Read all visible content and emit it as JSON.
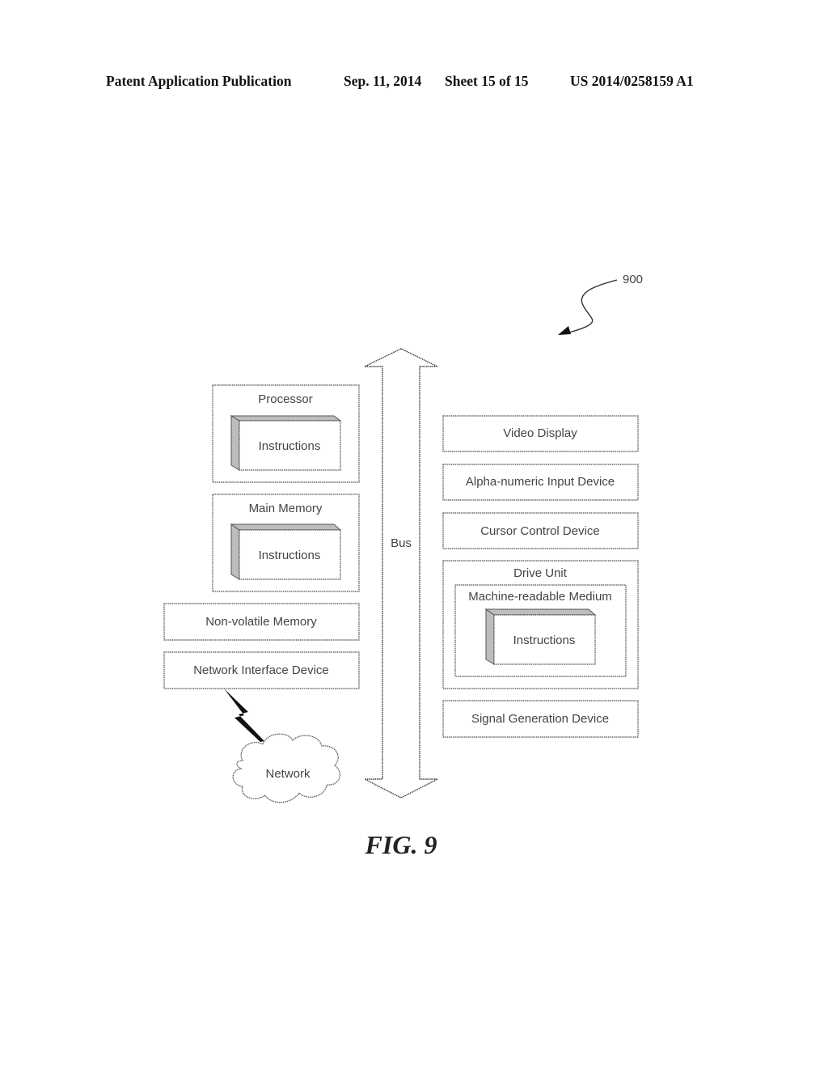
{
  "header": {
    "publication": "Patent Application Publication",
    "date": "Sep. 11, 2014",
    "sheet": "Sheet 15 of 15",
    "number": "US 2014/0258159 A1"
  },
  "figure": {
    "reference_numeral": "900",
    "caption": "FIG. 9",
    "bus_label": "Bus",
    "left_components": {
      "processor": {
        "title": "Processor",
        "inner": "Instructions"
      },
      "main_memory": {
        "title": "Main Memory",
        "inner": "Instructions"
      },
      "non_volatile_memory": "Non-volatile Memory",
      "network_interface_device": "Network Interface Device",
      "network": "Network"
    },
    "right_components": {
      "video_display": "Video Display",
      "alpha_numeric_input_device": "Alpha-numeric Input Device",
      "cursor_control_device": "Cursor Control Device",
      "drive_unit": {
        "title": "Drive Unit",
        "medium": "Machine-readable Medium",
        "inner": "Instructions"
      },
      "signal_generation_device": "Signal Generation Device"
    }
  }
}
